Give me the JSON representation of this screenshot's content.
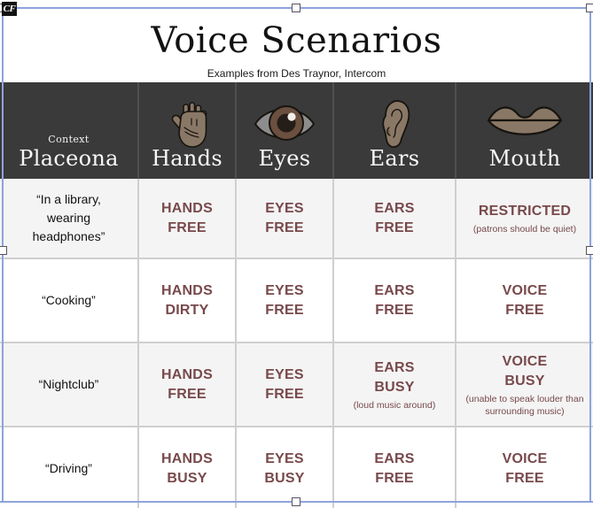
{
  "badge": {
    "label": "CF"
  },
  "title": {
    "heading": "Voice Scenarios",
    "subheading": "Examples from Des Traynor, Intercom"
  },
  "colors": {
    "header_background": "#3a3a3a",
    "header_text": "#f7f7f7",
    "state_text": "#78494b",
    "context_text": "#111111",
    "alt_row_background": "#f4f4f4",
    "row_background": "#ffffff",
    "selection_outline": "#8ea3dd",
    "skin_tone": "#8a7866",
    "skin_shadow": "#6d5d4d",
    "iris": "#6b4f3f",
    "sclera": "#8d8d8d"
  },
  "table": {
    "headers": [
      {
        "eyebrow": "Context",
        "label": "Placeona",
        "icon": "none"
      },
      {
        "eyebrow": "",
        "label": "Hands",
        "icon": "hand-icon"
      },
      {
        "eyebrow": "",
        "label": "Eyes",
        "icon": "eye-icon"
      },
      {
        "eyebrow": "",
        "label": "Ears",
        "icon": "ear-icon"
      },
      {
        "eyebrow": "",
        "label": "Mouth",
        "icon": "mouth-icon"
      }
    ],
    "rows": [
      {
        "context": "“In a library, wearing headphones”",
        "hands": {
          "state": "HANDS FREE",
          "note": ""
        },
        "eyes": {
          "state": "EYES FREE",
          "note": ""
        },
        "ears": {
          "state": "EARS FREE",
          "note": ""
        },
        "mouth": {
          "state": "RESTRICTED",
          "note": "(patrons should be quiet)"
        }
      },
      {
        "context": "“Cooking”",
        "hands": {
          "state": "HANDS DIRTY",
          "note": ""
        },
        "eyes": {
          "state": "EYES FREE",
          "note": ""
        },
        "ears": {
          "state": "EARS FREE",
          "note": ""
        },
        "mouth": {
          "state": "VOICE FREE",
          "note": ""
        }
      },
      {
        "context": "“Nightclub”",
        "hands": {
          "state": "HANDS FREE",
          "note": ""
        },
        "eyes": {
          "state": "EYES FREE",
          "note": ""
        },
        "ears": {
          "state": "EARS BUSY",
          "note": "(loud music around)"
        },
        "mouth": {
          "state": "VOICE BUSY",
          "note": "(unable to speak louder than surrounding music)"
        }
      },
      {
        "context": "“Driving”",
        "hands": {
          "state": "HANDS BUSY",
          "note": ""
        },
        "eyes": {
          "state": "EYES BUSY",
          "note": ""
        },
        "ears": {
          "state": "EARS FREE",
          "note": ""
        },
        "mouth": {
          "state": "VOICE FREE",
          "note": ""
        }
      }
    ]
  },
  "cell_lines": {
    "r0": {
      "context": [
        "“In a library,",
        "wearing",
        "headphones”"
      ],
      "hands": [
        "HANDS",
        "FREE"
      ],
      "eyes": [
        "EYES",
        "FREE"
      ],
      "ears": [
        "EARS",
        "FREE"
      ],
      "mouth": [
        "RESTRICTED"
      ]
    },
    "r1": {
      "context": [
        "“Cooking”"
      ],
      "hands": [
        "HANDS",
        "DIRTY"
      ],
      "eyes": [
        "EYES",
        "FREE"
      ],
      "ears": [
        "EARS",
        "FREE"
      ],
      "mouth": [
        "VOICE",
        "FREE"
      ]
    },
    "r2": {
      "context": [
        "“Nightclub”"
      ],
      "hands": [
        "HANDS",
        "FREE"
      ],
      "eyes": [
        "EYES",
        "FREE"
      ],
      "ears": [
        "EARS",
        "BUSY"
      ],
      "mouth": [
        "VOICE",
        "BUSY"
      ]
    },
    "r3": {
      "context": [
        "“Driving”"
      ],
      "hands": [
        "HANDS",
        "BUSY"
      ],
      "eyes": [
        "EYES",
        "BUSY"
      ],
      "ears": [
        "EARS",
        "FREE"
      ],
      "mouth": [
        "VOICE",
        "FREE"
      ]
    }
  },
  "notes": {
    "r0_mouth": "(patrons should be quiet)",
    "r2_ears": "(loud music around)",
    "r2_mouth": "(unable to speak louder than surrounding music)"
  }
}
